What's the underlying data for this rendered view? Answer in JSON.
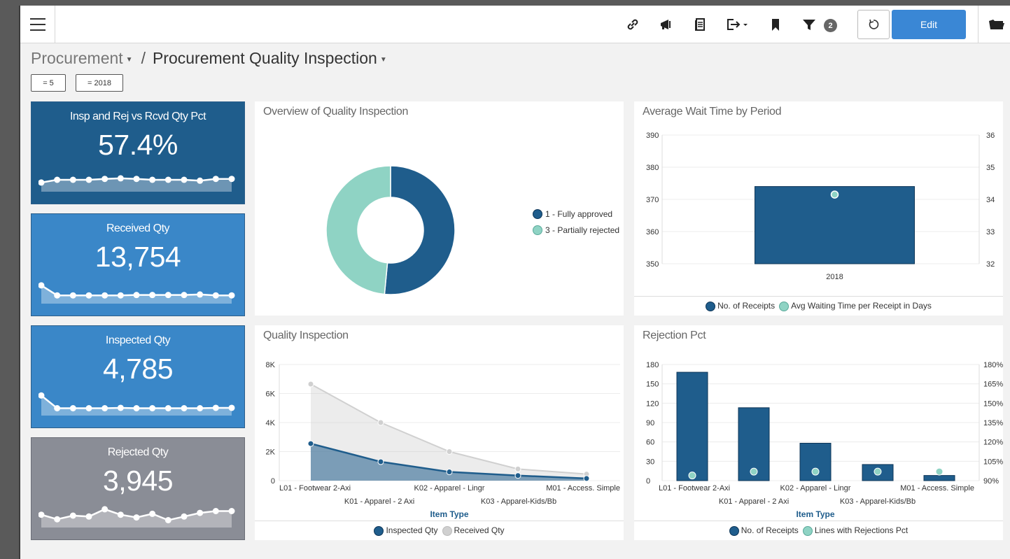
{
  "toolbar": {
    "icons": [
      "link-icon",
      "megaphone-icon",
      "document-icon",
      "export-icon",
      "bookmark-icon",
      "filter-icon",
      "refresh-icon",
      "folder-icon"
    ],
    "filter_count": "2",
    "edit_label": "Edit"
  },
  "breadcrumb": {
    "parent": "Procurement",
    "separator": "/",
    "current": "Procurement Quality Inspection"
  },
  "filters": [
    "= 5",
    "= 2018"
  ],
  "kpis": [
    {
      "title": "Insp and Rej vs Rcvd Qty Pct",
      "value": "57.4%",
      "color": "#1f5d8c",
      "sparkline": [
        0.35,
        0.5,
        0.5,
        0.5,
        0.55,
        0.58,
        0.55,
        0.5,
        0.5,
        0.5,
        0.45,
        0.55,
        0.55
      ]
    },
    {
      "title": "Received Qty",
      "value": "13,754",
      "color": "#3a87c8",
      "sparkline": [
        0.85,
        0.3,
        0.3,
        0.3,
        0.3,
        0.3,
        0.32,
        0.32,
        0.32,
        0.32,
        0.35,
        0.3,
        0.3
      ]
    },
    {
      "title": "Inspected Qty",
      "value": "4,785",
      "color": "#3a87c8",
      "sparkline": [
        0.95,
        0.25,
        0.25,
        0.25,
        0.25,
        0.27,
        0.25,
        0.25,
        0.25,
        0.25,
        0.25,
        0.27,
        0.27
      ]
    },
    {
      "title": "Rejected Qty",
      "value": "3,945",
      "color": "#8a8d96",
      "sparkline": [
        0.55,
        0.3,
        0.5,
        0.45,
        0.85,
        0.55,
        0.4,
        0.6,
        0.25,
        0.45,
        0.65,
        0.75,
        0.75
      ]
    }
  ],
  "overview": {
    "title": "Overview of Quality Inspection",
    "chart_data": {
      "type": "pie",
      "title": "Overview of Quality Inspection",
      "labels": [
        "1 - Fully approved",
        "3 - Partially rejected"
      ],
      "values": [
        51.5,
        48.5
      ],
      "colors": [
        "#1f5d8c",
        "#8fd3c4"
      ],
      "donut": true,
      "legend": "right"
    }
  },
  "wait_time": {
    "title": "Average Wait Time by Period",
    "chart_data": {
      "type": "bar",
      "title": "Average Wait Time by Period",
      "categories": [
        "2018"
      ],
      "series": [
        {
          "name": "No. of Receipts",
          "values": [
            374
          ],
          "axis": "left",
          "color": "#1f5d8c"
        },
        {
          "name": "Avg Waiting Time per Receipt in Days",
          "values": [
            34.15
          ],
          "axis": "right",
          "kind": "point",
          "color": "#8fd3c4"
        }
      ],
      "ylim": [
        350,
        390
      ],
      "y2lim": [
        32,
        36
      ],
      "yticks": [
        "390",
        "380",
        "370",
        "360",
        "350"
      ],
      "y2ticks": [
        "36",
        "35",
        "34",
        "33",
        "32"
      ],
      "legend": "bottom"
    },
    "legend": [
      "No. of Receipts",
      "Avg Waiting Time per Receipt in Days"
    ]
  },
  "quality": {
    "title": "Quality Inspection",
    "chart_data": {
      "type": "area",
      "title": "Quality Inspection",
      "categories": [
        "L01 - Footwear 2-Axi",
        "K01 - Apparel - 2 Axi",
        "K02 - Apparel - Lingr",
        "K03 - Apparel-Kids/Bb",
        "M01 - Access. Simple"
      ],
      "series": [
        {
          "name": "Inspected Qty",
          "values": [
            2550,
            1300,
            600,
            350,
            150
          ],
          "color": "#1f5d8c"
        },
        {
          "name": "Received Qty",
          "values": [
            6650,
            4000,
            2000,
            800,
            450
          ],
          "color": "#d0d0d0"
        }
      ],
      "xlabel": "Item Type",
      "ylim": [
        0,
        8000
      ],
      "yticks": [
        "8K",
        "6K",
        "4K",
        "2K",
        "0"
      ],
      "legend": "bottom"
    },
    "legend": [
      "Inspected Qty",
      "Received Qty"
    ]
  },
  "rejection": {
    "title": "Rejection Pct",
    "chart_data": {
      "type": "bar",
      "title": "Rejection Pct",
      "categories": [
        "L01 - Footwear 2-Axi",
        "K01 - Apparel - 2 Axi",
        "K02 - Apparel - Lingr",
        "K03 - Apparel-Kids/Bb",
        "M01 - Access. Simple"
      ],
      "series": [
        {
          "name": "No. of Receipts",
          "values": [
            168,
            113,
            58,
            25,
            8
          ],
          "axis": "left",
          "color": "#1f5d8c"
        },
        {
          "name": "Lines with Rejections Pct",
          "values": [
            94,
            97,
            97,
            97,
            97
          ],
          "axis": "right",
          "kind": "point",
          "color": "#8fd3c4"
        }
      ],
      "xlabel": "Item Type",
      "ylim": [
        0,
        180
      ],
      "y2lim": [
        90,
        180
      ],
      "yticks": [
        "180",
        "150",
        "120",
        "90",
        "60",
        "30",
        "0"
      ],
      "y2ticks": [
        "180%",
        "165%",
        "150%",
        "135%",
        "120%",
        "105%",
        "90%"
      ],
      "legend": "bottom"
    },
    "legend": [
      "No. of Receipts",
      "Lines with Rejections Pct"
    ]
  }
}
